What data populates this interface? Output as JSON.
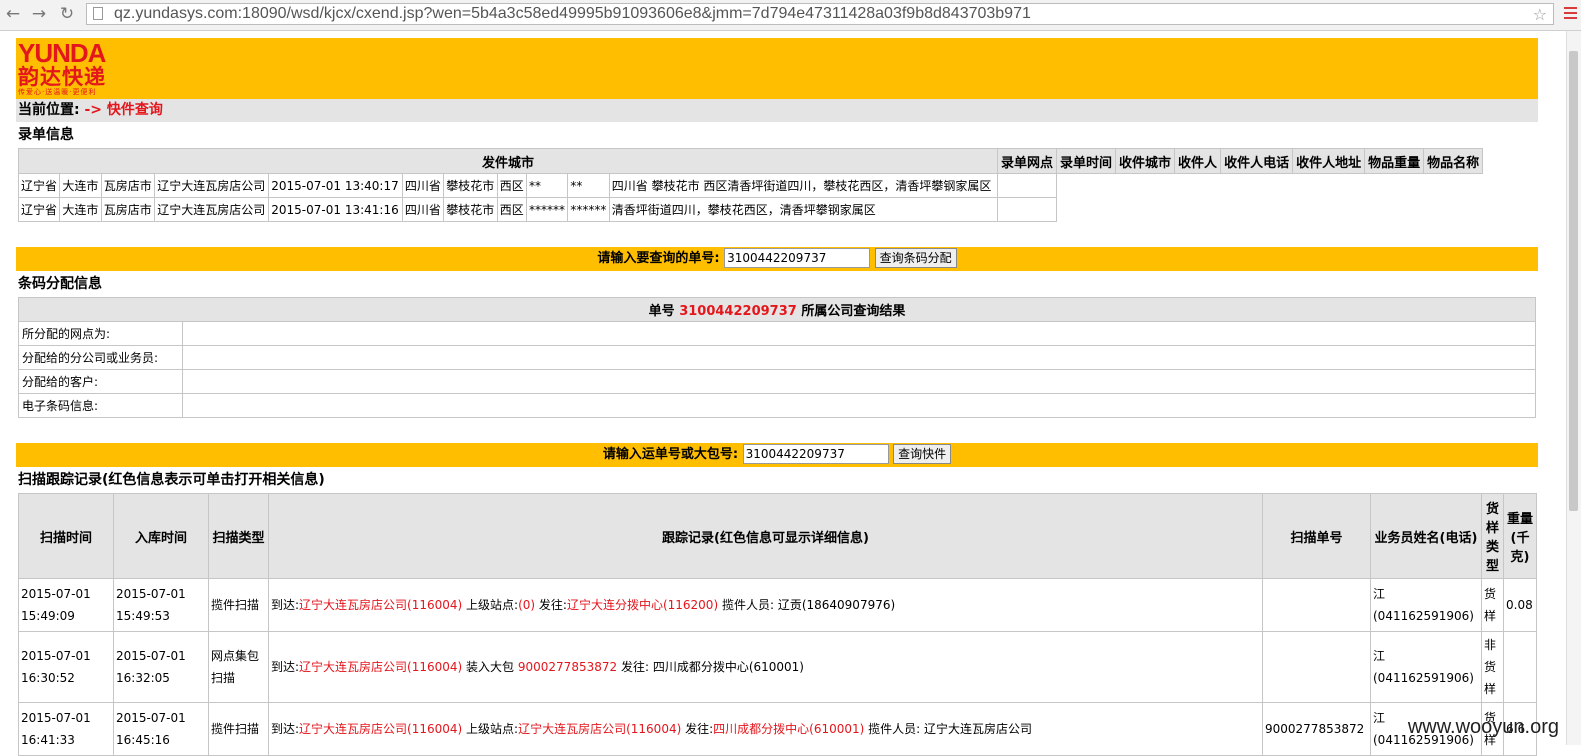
{
  "browser": {
    "url": "qz.yundasys.com:18090/wsd/kjcx/cxend.jsp?wen=5b4a3c58ed49995b91093606e8&jmm=7d794e47311428a03f9b8d843703b971"
  },
  "logo": {
    "en": "YUNDA",
    "cn": "韵达快递",
    "slogan": "传爱心·送温暖·更便利"
  },
  "location": {
    "label": "当前位置:",
    "crumb": "-> 快件查询"
  },
  "record_section": {
    "title": "录单信息",
    "headers": [
      "发件城市",
      "录单网点",
      "录单时间",
      "收件城市",
      "收件人",
      "收件人电话",
      "收件人地址",
      "物品重量",
      "物品名称"
    ],
    "rows": [
      [
        "辽宁省",
        "大连市",
        "瓦房店市",
        "辽宁大连瓦房店公司",
        "2015-07-01 13:40:17",
        "四川省",
        "攀枝花市",
        "西区",
        "**",
        "**",
        "四川省 攀枝花市 西区清香坪街道四川，攀枝花西区，清香坪攀钢家属区"
      ],
      [
        "辽宁省",
        "大连市",
        "瓦房店市",
        "辽宁大连瓦房店公司",
        "2015-07-01 13:41:16",
        "四川省",
        "攀枝花市",
        "西区",
        "******",
        "******",
        "清香坪街道四川，攀枝花西区，清香坪攀钢家属区"
      ]
    ]
  },
  "query1": {
    "label": "请输入要查询的单号:",
    "value": "3100442209737",
    "button": "查询条码分配"
  },
  "barcode_section": {
    "title": "条码分配信息",
    "header_prefix": "单号",
    "header_number": "3100442209737",
    "header_suffix": "所属公司查询结果",
    "rows": [
      {
        "label": "所分配的网点为:",
        "value": ""
      },
      {
        "label": "分配给的分公司或业务员:",
        "value": ""
      },
      {
        "label": "分配给的客户:",
        "value": ""
      },
      {
        "label": "电子条码信息:",
        "value": ""
      }
    ]
  },
  "query2": {
    "label": "请输入运单号或大包号:",
    "value": "3100442209737",
    "button": "查询快件"
  },
  "scan_section": {
    "title": "扫描跟踪记录(红色信息表示可单击打开相关信息)",
    "headers": [
      "扫描时间",
      "入库时间",
      "扫描类型",
      "跟踪记录(红色信息可显示详细信息)",
      "扫描单号",
      "业务员姓名(电话)",
      "货样类型",
      "重量(千克)"
    ],
    "rows": [
      {
        "scan_time": "2015-07-01 15:49:09",
        "in_time": "2015-07-01 15:49:53",
        "type": "揽件扫描",
        "trace": [
          {
            "t": "到达:",
            "red": false
          },
          {
            "t": "辽宁大连瓦房店公司(116004)",
            "red": true
          },
          {
            "t": " 上级站点:",
            "red": false
          },
          {
            "t": "(0)",
            "red": true
          },
          {
            "t": " 发往:",
            "red": false
          },
          {
            "t": "辽宁大连分拨中心(116200)",
            "red": true
          },
          {
            "t": " 揽件人员: 辽贡(18640907976)",
            "red": false
          }
        ],
        "scan_no": "",
        "staff": "江(041162591906)",
        "sample": "货样",
        "weight": "0.08"
      },
      {
        "scan_time": "2015-07-01 16:30:52",
        "in_time": "2015-07-01 16:32:05",
        "type": "网点集包扫描",
        "trace": [
          {
            "t": "到达:",
            "red": false
          },
          {
            "t": "辽宁大连瓦房店公司(116004)",
            "red": true
          },
          {
            "t": " 装入大包 ",
            "red": false
          },
          {
            "t": "9000277853872",
            "red": true
          },
          {
            "t": " 发往: 四川成都分拨中心(610001)",
            "red": false
          }
        ],
        "scan_no": "",
        "staff": "江(041162591906)",
        "sample": "非货样",
        "weight": ""
      },
      {
        "scan_time": "2015-07-01 16:41:33",
        "in_time": "2015-07-01 16:45:16",
        "type": "揽件扫描",
        "trace": [
          {
            "t": "到达:",
            "red": false
          },
          {
            "t": "辽宁大连瓦房店公司(116004)",
            "red": true
          },
          {
            "t": " 上级站点:",
            "red": false
          },
          {
            "t": "辽宁大连瓦房店公司(116004)",
            "red": true
          },
          {
            "t": " 发往:",
            "red": false
          },
          {
            "t": "四川成都分拨中心(610001)",
            "red": true
          },
          {
            "t": " 揽件人员: 辽宁大连瓦房店公司",
            "red": false
          }
        ],
        "scan_no": "9000277853872",
        "staff": "江(041162591906)",
        "sample": "货样",
        "weight": "6.6"
      }
    ]
  },
  "watermark": "www.wooyun.org",
  "colors": {
    "banner": "#ffbe00",
    "brand_red": "#e3161c",
    "header_gray": "#e4e4e4"
  }
}
